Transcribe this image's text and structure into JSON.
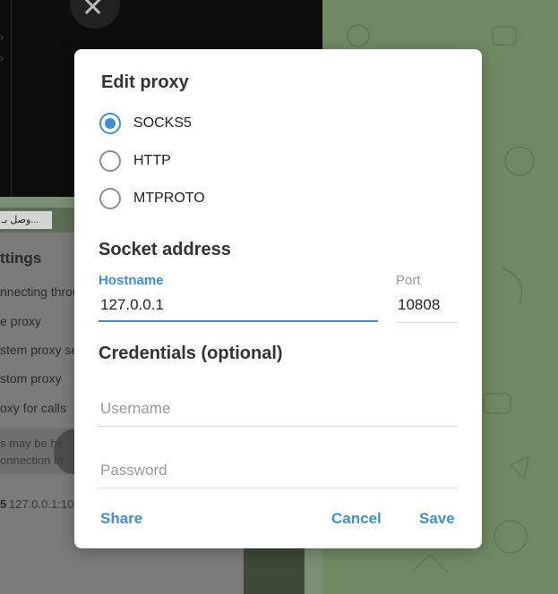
{
  "background": {
    "chip_text": "...وصل بـ",
    "settings_title": "ttings",
    "settings_items": [
      "nnecting throu",
      "e proxy",
      "stem proxy set",
      "stom proxy",
      "oxy for calls"
    ],
    "note_lines": [
      "s may be he",
      "onnection in"
    ],
    "proxy_line_prefix": "5",
    "proxy_line_address": "127.0.0.1:10"
  },
  "dialog": {
    "title": "Edit proxy",
    "proxy_types": [
      {
        "label": "SOCKS5",
        "selected": true
      },
      {
        "label": "HTTP",
        "selected": false
      },
      {
        "label": "MTPROTO",
        "selected": false
      }
    ],
    "socket_section_title": "Socket address",
    "hostname": {
      "label": "Hostname",
      "value": "127.0.0.1"
    },
    "port": {
      "label": "Port",
      "value": "10808"
    },
    "credentials_section_title": "Credentials (optional)",
    "username": {
      "placeholder": "Username",
      "value": ""
    },
    "password": {
      "placeholder": "Password",
      "value": ""
    },
    "buttons": {
      "share": "Share",
      "cancel": "Cancel",
      "save": "Save"
    }
  },
  "colors": {
    "accent": "#3e8fd3",
    "dialog_bg": "#ffffff",
    "wallpaper": "#6f8a63"
  }
}
